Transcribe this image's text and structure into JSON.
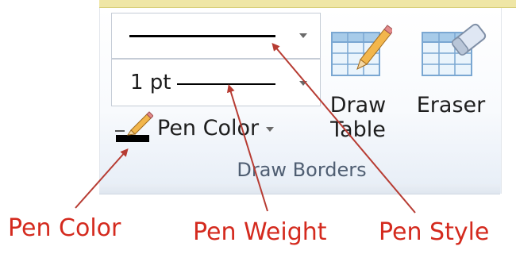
{
  "ribbon": {
    "group_title": "Draw Borders",
    "pen_style": {
      "selected": "solid line"
    },
    "pen_weight": {
      "selected": "1 pt"
    },
    "pen_color": {
      "label": "Pen Color"
    },
    "draw_table": {
      "label_line1": "Draw",
      "label_line2": "Table"
    },
    "eraser": {
      "label": "Eraser"
    }
  },
  "callouts": {
    "pen_color": "Pen Color",
    "pen_weight": "Pen Weight",
    "pen_style": "Pen Style"
  },
  "colors": {
    "callout_text": "#d42a1e",
    "arrow": "#b73c33",
    "group_title": "#4f5e72",
    "ribbon_top": "#efe6a6"
  },
  "icons": {
    "pen_color": "pencil-over-black-bar",
    "draw_table": "table-with-pencil",
    "eraser": "table-with-eraser"
  }
}
